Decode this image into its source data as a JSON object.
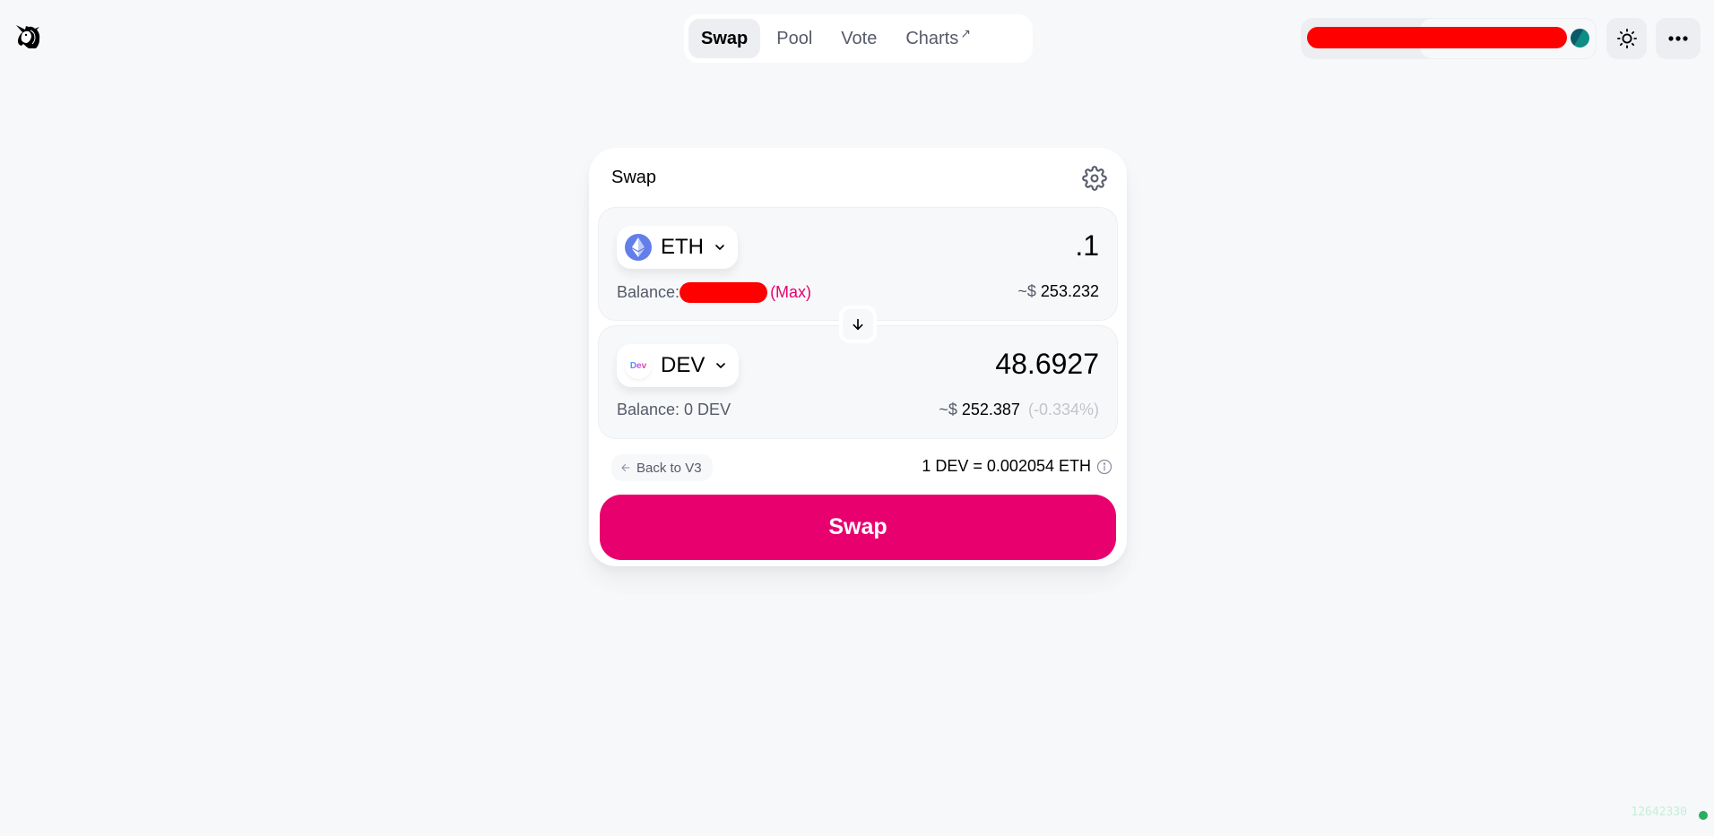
{
  "header": {
    "logo": "uniswap-unicorn-logo",
    "nav": [
      {
        "label": "Swap",
        "active": true,
        "external": false
      },
      {
        "label": "Pool",
        "active": false,
        "external": false
      },
      {
        "label": "Vote",
        "active": false,
        "external": false
      },
      {
        "label": "Charts",
        "active": false,
        "external": true,
        "external_glyph": "↗"
      }
    ],
    "account": {
      "address": "[redacted]",
      "avatar": "jazzicon"
    },
    "theme_icon": "sun-icon",
    "menu_icon": "more-horizontal-icon"
  },
  "swap": {
    "title": "Swap",
    "settings_icon": "gear-icon",
    "input": {
      "token": "ETH",
      "amount": ".1",
      "balance_label": "Balance:",
      "balance_value": "[redacted]",
      "max_label": "(Max)",
      "usd_prefix": "~$",
      "usd_value": "253.232"
    },
    "output": {
      "token": "DEV",
      "token_icon_text": "Dev",
      "amount": "48.6927",
      "balance_label": "Balance: 0 DEV",
      "usd_prefix": "~$",
      "usd_value": "252.387",
      "price_impact": "(-0.334%)"
    },
    "back_to_v3": "Back to V3",
    "rate": "1 DEV = 0.002054 ETH",
    "swap_button": "Swap"
  },
  "status": {
    "block_number": "12642330",
    "colors": {
      "dot": "#27ae60"
    }
  },
  "colors": {
    "accent": "#e8006f",
    "background": "#f7f8fa",
    "panel": "#f7f8fa",
    "text_secondary": "#565a69",
    "eth": "#627eea"
  }
}
